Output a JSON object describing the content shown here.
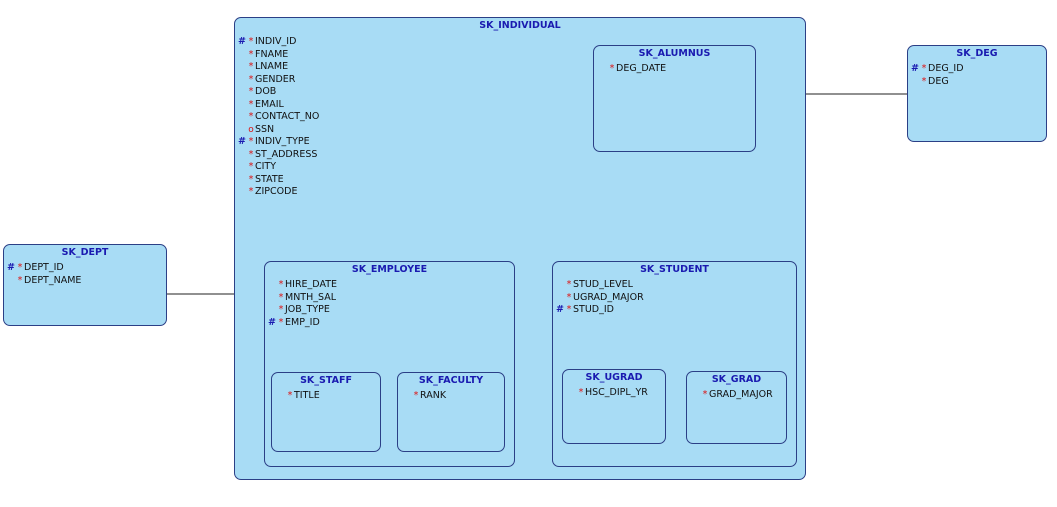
{
  "entities": {
    "individual": {
      "title": "SK_INDIVIDUAL",
      "attrs": [
        {
          "pk": "#",
          "mark": "*",
          "name": "INDIV_ID"
        },
        {
          "pk": "",
          "mark": "*",
          "name": "FNAME"
        },
        {
          "pk": "",
          "mark": "*",
          "name": "LNAME"
        },
        {
          "pk": "",
          "mark": "*",
          "name": "GENDER"
        },
        {
          "pk": "",
          "mark": "*",
          "name": "DOB"
        },
        {
          "pk": "",
          "mark": "*",
          "name": "EMAIL"
        },
        {
          "pk": "",
          "mark": "*",
          "name": "CONTACT_NO"
        },
        {
          "pk": "",
          "mark": "o",
          "name": "SSN"
        },
        {
          "pk": "#",
          "mark": "*",
          "name": "INDIV_TYPE"
        },
        {
          "pk": "",
          "mark": "*",
          "name": "ST_ADDRESS"
        },
        {
          "pk": "",
          "mark": "*",
          "name": "CITY"
        },
        {
          "pk": "",
          "mark": "*",
          "name": "STATE"
        },
        {
          "pk": "",
          "mark": "*",
          "name": "ZIPCODE"
        }
      ]
    },
    "alumnus": {
      "title": "SK_ALUMNUS",
      "attrs": [
        {
          "pk": "",
          "mark": "*",
          "name": "DEG_DATE"
        }
      ]
    },
    "deg": {
      "title": "SK_DEG",
      "attrs": [
        {
          "pk": "#",
          "mark": "*",
          "name": "DEG_ID"
        },
        {
          "pk": "",
          "mark": "*",
          "name": "DEG"
        }
      ]
    },
    "dept": {
      "title": "SK_DEPT",
      "attrs": [
        {
          "pk": "#",
          "mark": "*",
          "name": "DEPT_ID"
        },
        {
          "pk": "",
          "mark": "*",
          "name": "DEPT_NAME"
        }
      ]
    },
    "employee": {
      "title": "SK_EMPLOYEE",
      "attrs": [
        {
          "pk": "",
          "mark": "*",
          "name": "HIRE_DATE"
        },
        {
          "pk": "",
          "mark": "*",
          "name": "MNTH_SAL"
        },
        {
          "pk": "",
          "mark": "*",
          "name": "JOB_TYPE"
        },
        {
          "pk": "#",
          "mark": "*",
          "name": "EMP_ID"
        }
      ]
    },
    "staff": {
      "title": "SK_STAFF",
      "attrs": [
        {
          "pk": "",
          "mark": "*",
          "name": "TITLE"
        }
      ]
    },
    "faculty": {
      "title": "SK_FACULTY",
      "attrs": [
        {
          "pk": "",
          "mark": "*",
          "name": "RANK"
        }
      ]
    },
    "student": {
      "title": "SK_STUDENT",
      "attrs": [
        {
          "pk": "",
          "mark": "*",
          "name": "STUD_LEVEL"
        },
        {
          "pk": "",
          "mark": "*",
          "name": "UGRAD_MAJOR"
        },
        {
          "pk": "#",
          "mark": "*",
          "name": "STUD_ID"
        }
      ]
    },
    "ugrad": {
      "title": "SK_UGRAD",
      "attrs": [
        {
          "pk": "",
          "mark": "*",
          "name": "HSC_DIPL_YR"
        }
      ]
    },
    "grad": {
      "title": "SK_GRAD",
      "attrs": [
        {
          "pk": "",
          "mark": "*",
          "name": "GRAD_MAJOR"
        }
      ]
    }
  },
  "colors": {
    "entity_fill": "#a8dcf5",
    "entity_border": "#2b3f86",
    "title": "#1a1ab0",
    "required_mark": "#dd1111",
    "pk_mark": "#1a1ab0"
  }
}
